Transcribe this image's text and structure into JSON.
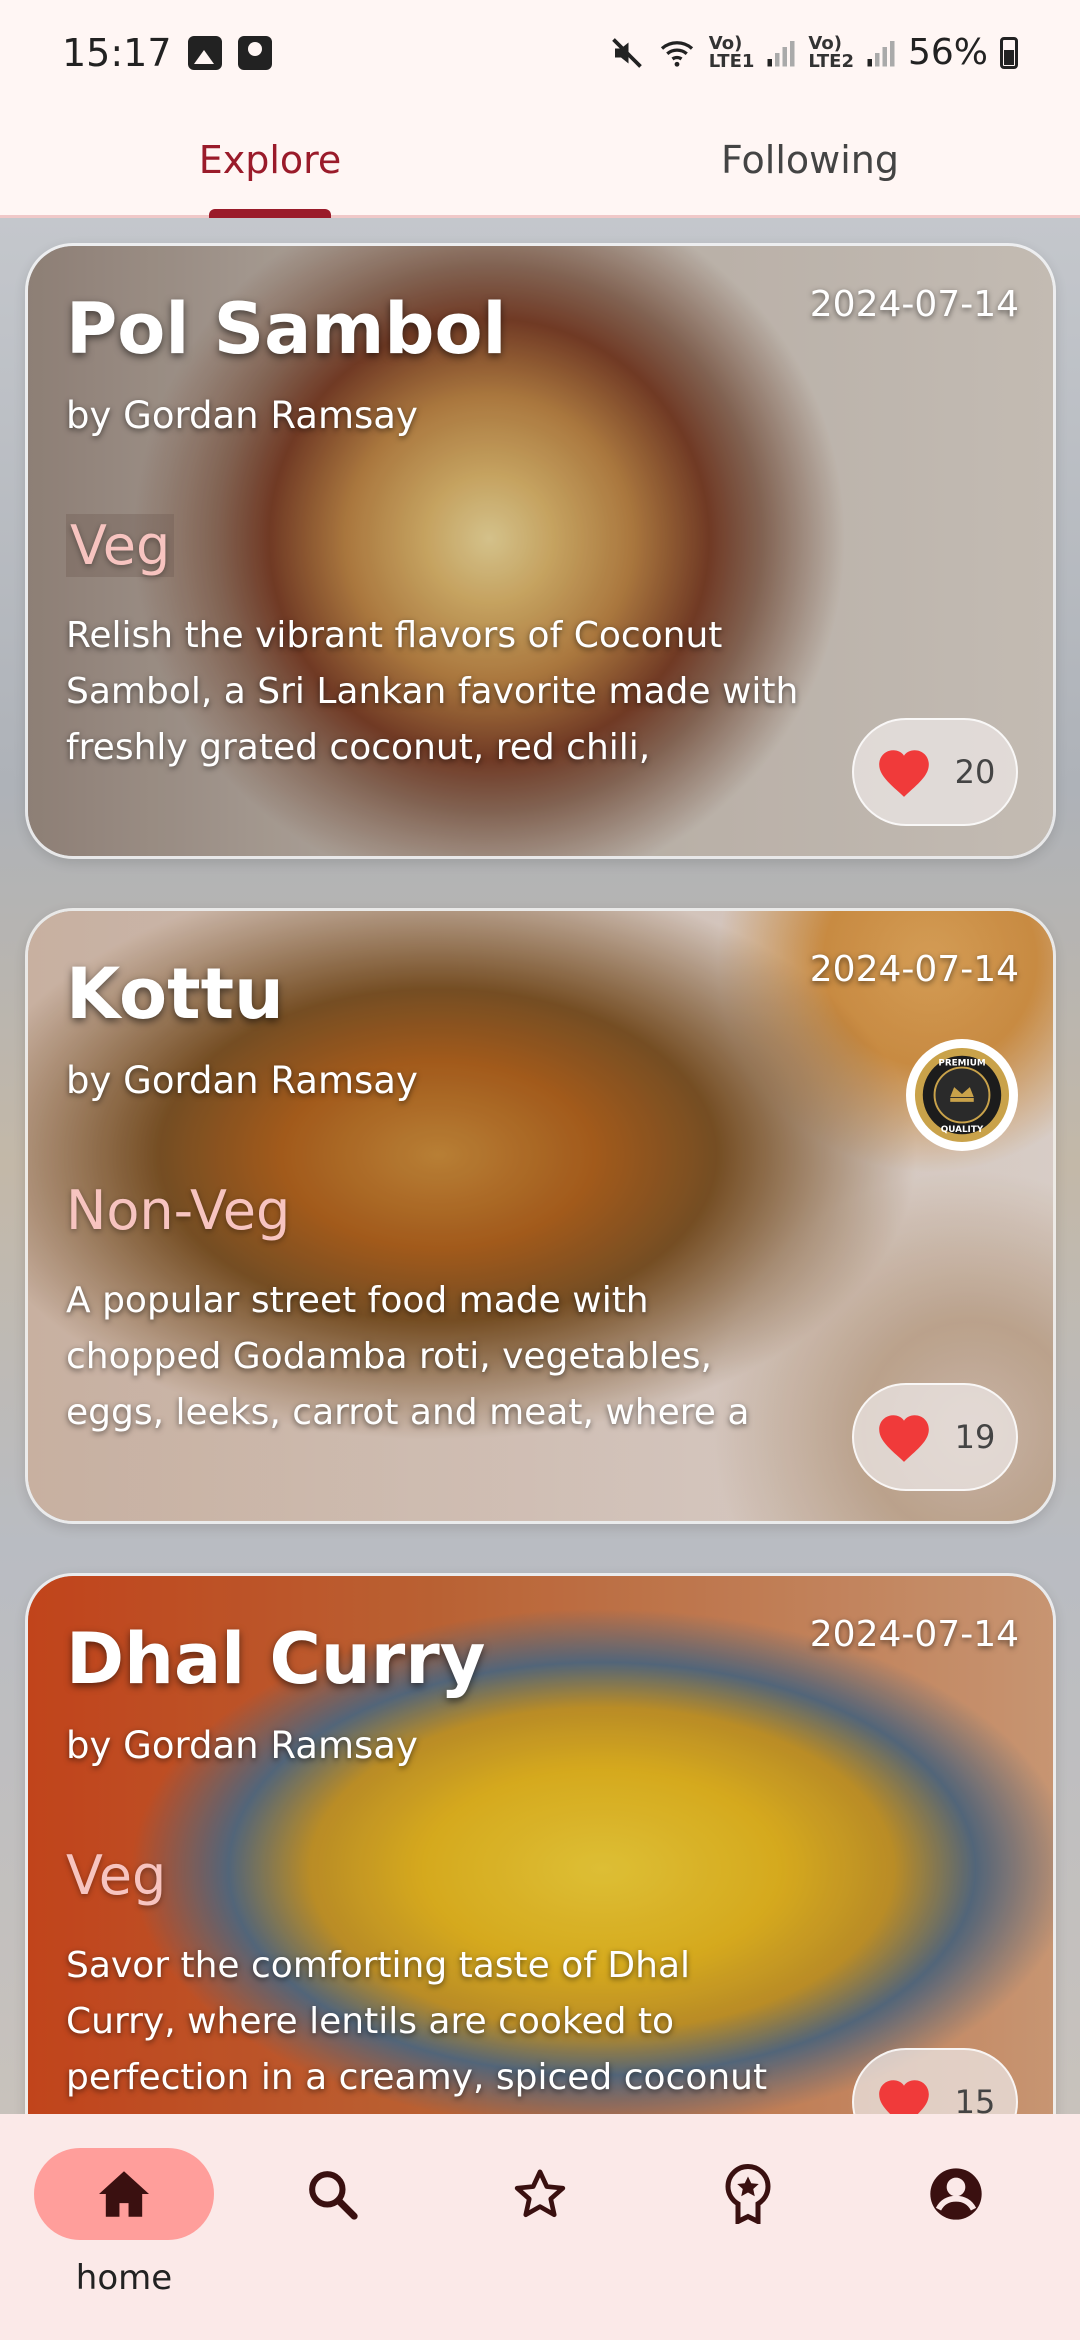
{
  "status_bar": {
    "time": "15:17",
    "battery": "56%",
    "sim1_label": "Vo)\nLTE1",
    "sim2_label": "Vo)\nLTE2",
    "icons": [
      "gallery-icon",
      "contact-card-icon",
      "mute-icon",
      "wifi-icon",
      "signal-icon",
      "battery-icon"
    ]
  },
  "tabs": [
    {
      "label": "Explore",
      "active": true
    },
    {
      "label": "Following",
      "active": false
    }
  ],
  "recipes": [
    {
      "title": "Pol Sambol",
      "author": "by Gordan Ramsay",
      "date": "2024-07-14",
      "type": "Veg",
      "description": "Relish the vibrant flavors of Coconut Sambol, a Sri Lankan favorite made with freshly grated coconut, red chili,",
      "likes": "20"
    },
    {
      "title": "Kottu",
      "author": "by Gordan Ramsay",
      "date": "2024-07-14",
      "type": "Non-Veg",
      "description": "A popular street food made with chopped Godamba roti, vegetables, eggs, leeks, carrot and meat, where a",
      "likes": "19",
      "badge": "premium-quality-badge"
    },
    {
      "title": "Dhal Curry",
      "author": "by Gordan Ramsay",
      "date": "2024-07-14",
      "type": "Veg",
      "description": "Savor the comforting taste of Dhal Curry, where lentils are cooked to perfection in a creamy, spiced coconut",
      "likes": "15"
    }
  ],
  "badge_text": {
    "top": "PREMIUM",
    "bottom": "QUALITY"
  },
  "bottom_nav": {
    "home_label": "home",
    "items": [
      "home-icon",
      "search-icon",
      "star-icon",
      "award-icon",
      "account-icon"
    ]
  },
  "colors": {
    "accent": "#9a1b2a",
    "heart": "#f03a3a",
    "nav_active": "#ff9e9b",
    "veg_label": "#f7c4c0"
  }
}
